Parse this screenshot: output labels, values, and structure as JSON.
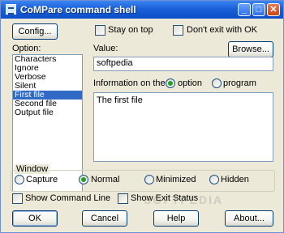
{
  "window": {
    "title": "CoMPare command shell"
  },
  "titlebar_buttons": {
    "minimize": "_",
    "maximize": "□",
    "close": "✕"
  },
  "config": {
    "label": "Config..."
  },
  "stay_on_top": {
    "label": "Stay on top",
    "checked": false
  },
  "dont_exit": {
    "label": "Don't exit with OK",
    "checked": false
  },
  "option": {
    "label": "Option:",
    "items": [
      "Characters",
      "Ignore",
      "Verbose",
      "Silent",
      "First file",
      "Second file",
      "Output file"
    ],
    "selected": "First file"
  },
  "value": {
    "label": "Value:",
    "text": "softpedia",
    "browse_label": "Browse..."
  },
  "information": {
    "label": "Information on the",
    "option_label": "option",
    "program_label": "program",
    "selected": "option",
    "text": "The first file"
  },
  "window_group": {
    "title": "Window",
    "options": [
      "Capture",
      "Normal",
      "Minimized",
      "Hidden"
    ],
    "selected": "Normal"
  },
  "show_command_line": {
    "label": "Show Command Line",
    "checked": false
  },
  "show_exit_status": {
    "label": "Show Exit Status",
    "checked": false
  },
  "buttons": {
    "ok": "OK",
    "cancel": "Cancel",
    "help": "Help",
    "about": "About..."
  },
  "watermark": "SOFTPEDIA"
}
